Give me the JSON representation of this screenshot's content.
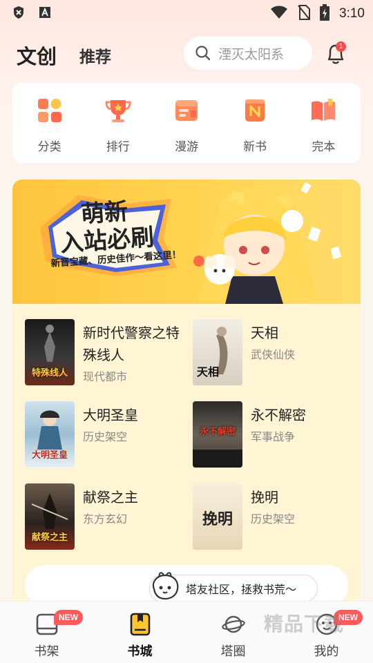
{
  "status_bar": {
    "time": "3:10"
  },
  "header": {
    "brand": "文创",
    "tab": "推荐",
    "search_placeholder": "湮灭太阳系",
    "notification_count": "1"
  },
  "quick_nav": [
    {
      "label": "分类",
      "icon": "category-grid-icon",
      "color": "#ff7a52"
    },
    {
      "label": "排行",
      "icon": "trophy-icon",
      "color": "#ff6a4d"
    },
    {
      "label": "漫游",
      "icon": "roam-card-icon",
      "color": "#ff8a5c"
    },
    {
      "label": "新书",
      "icon": "new-book-icon",
      "color": "#ff7b45"
    },
    {
      "label": "完本",
      "icon": "open-book-icon",
      "color": "#ff6c55"
    }
  ],
  "banner": {
    "headline_1": "萌新",
    "headline_2": "入站必刷",
    "subtitle": "新晋宝藏、历史佳作～看这里！"
  },
  "books": [
    {
      "title": "新时代警察之特殊线人",
      "genre": "现代都市",
      "cover_text": "特殊线人",
      "cover_color": "#2b2b2b"
    },
    {
      "title": "天相",
      "genre": "武侠仙侠",
      "cover_text": "天相",
      "cover_color": "#e8e2d6"
    },
    {
      "title": "大明圣皇",
      "genre": "历史架空",
      "cover_text": "大明圣皇",
      "cover_color": "#8fb3c9"
    },
    {
      "title": "永不解密",
      "genre": "军事战争",
      "cover_text": "永不解密",
      "cover_color": "#5a5550"
    },
    {
      "title": "献祭之主",
      "genre": "东方玄幻",
      "cover_text": "献祭之主",
      "cover_color": "#3a3430"
    },
    {
      "title": "挽明",
      "genre": "历史架空",
      "cover_text": "挽明",
      "cover_color": "#efe2c8"
    }
  ],
  "tip": {
    "text": "塔友社区，拯救书荒～"
  },
  "bottom_nav": [
    {
      "label": "书架",
      "icon": "bookshelf-icon",
      "badge": "NEW",
      "active": false
    },
    {
      "label": "书城",
      "icon": "bookstore-icon",
      "badge": "",
      "active": true
    },
    {
      "label": "塔圈",
      "icon": "planet-icon",
      "badge": "",
      "active": false
    },
    {
      "label": "我的",
      "icon": "profile-face-icon",
      "badge": "NEW",
      "active": false
    }
  ],
  "watermark": "精品下载",
  "colors": {
    "accent_yellow": "#ffc43d",
    "badge_red": "#ff5a5a",
    "card_bg": "#fff4d4"
  }
}
